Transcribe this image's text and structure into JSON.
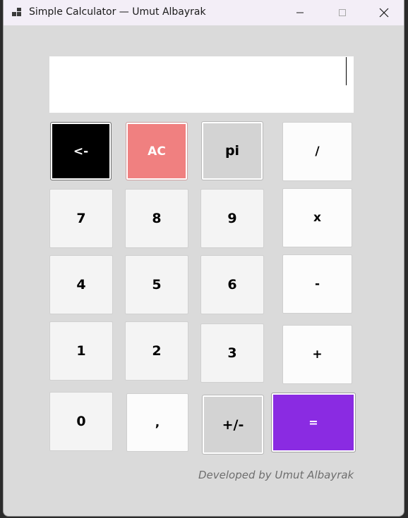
{
  "window": {
    "title": "Simple Calculator — Umut Albayrak"
  },
  "display": {
    "value": ""
  },
  "buttons": {
    "backspace": "<-",
    "clear": "AC",
    "pi": "pi",
    "divide": "/",
    "seven": "7",
    "eight": "8",
    "nine": "9",
    "multiply": "x",
    "four": "4",
    "five": "5",
    "six": "6",
    "subtract": "-",
    "one": "1",
    "two": "2",
    "three": "3",
    "add": "+",
    "zero": "0",
    "comma": ",",
    "negate": "+/-",
    "equals": "="
  },
  "footer": {
    "credit": "Developed by Umut Albayrak"
  },
  "colors": {
    "backspace_bg": "#000000",
    "clear_bg": "#f08080",
    "equals_bg": "#8a2be2",
    "window_bg": "#dadada"
  }
}
